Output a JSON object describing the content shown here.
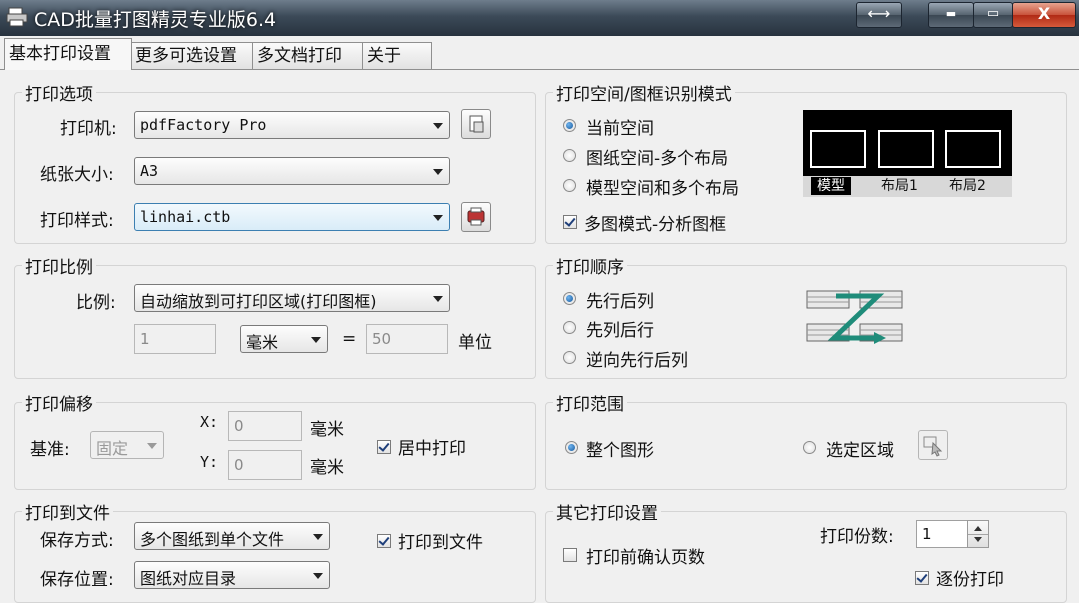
{
  "window": {
    "title": "CAD批量打图精灵专业版6.4",
    "controls": {
      "swap": "⟷",
      "minimize": "▬",
      "maximize": "▭",
      "close": "X"
    }
  },
  "tabs": [
    "基本打印设置",
    "更多可选设置",
    "多文档打印",
    "关于"
  ],
  "print_options": {
    "legend": "打印选项",
    "printer_label": "打印机:",
    "printer_value": "pdfFactory Pro",
    "paper_label": "纸张大小:",
    "paper_value": "A3",
    "style_label": "打印样式:",
    "style_value": "linhai.ctb"
  },
  "print_scale": {
    "legend": "打印比例",
    "scale_label": "比例:",
    "scale_value": "自动缩放到可打印区域(打印图框)",
    "left_value": "1",
    "unit_value": "毫米",
    "equals": "=",
    "right_value": "50",
    "unit_suffix": "单位"
  },
  "print_offset": {
    "legend": "打印偏移",
    "base_label": "基准:",
    "base_value": "固定",
    "x_label": "X:",
    "x_value": "0",
    "x_unit": "毫米",
    "y_label": "Y:",
    "y_value": "0",
    "y_unit": "毫米",
    "center_label": "居中打印",
    "center_checked": true
  },
  "print_to_file": {
    "legend": "打印到文件",
    "save_mode_label": "保存方式:",
    "save_mode_value": "多个图纸到单个文件",
    "save_loc_label": "保存位置:",
    "save_loc_value": "图纸对应目录",
    "to_file_label": "打印到文件",
    "to_file_checked": true
  },
  "space_mode": {
    "legend": "打印空间/图框识别模式",
    "options": [
      "当前空间",
      "图纸空间-多个布局",
      "模型空间和多个布局"
    ],
    "selected": 0,
    "multi_label": "多图模式-分析图框",
    "multi_checked": true,
    "preview_tabs": [
      "模型",
      "布局1",
      "布局2"
    ]
  },
  "print_order": {
    "legend": "打印顺序",
    "options": [
      "先行后列",
      "先列后行",
      "逆向先行后列"
    ],
    "selected": 0
  },
  "print_range": {
    "legend": "打印范围",
    "options": [
      "整个图形",
      "选定区域"
    ],
    "selected": 0
  },
  "other_settings": {
    "legend": "其它打印设置",
    "confirm_label": "打印前确认页数",
    "confirm_checked": false,
    "copies_label": "打印份数:",
    "copies_value": "1",
    "collate_label": "逐份打印",
    "collate_checked": true
  },
  "colors": {
    "title_bar": "#3c4a58",
    "close_button": "#c8523a",
    "radio_accent": "#185a9d",
    "arrow_accent": "#1f8c7a"
  }
}
